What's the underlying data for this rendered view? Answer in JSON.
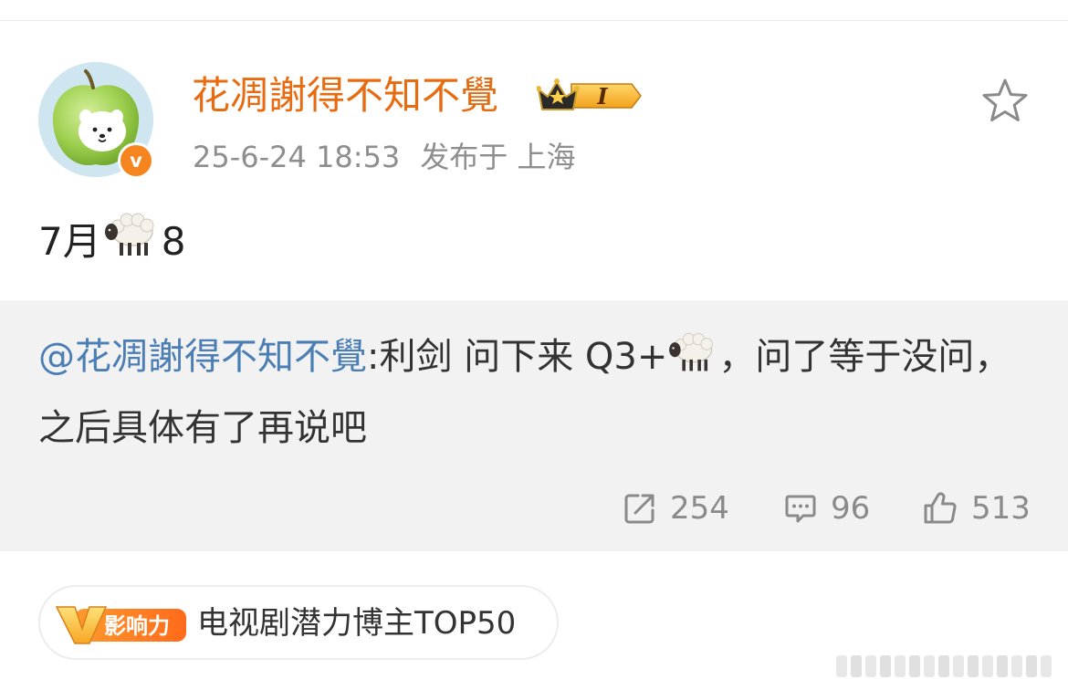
{
  "post": {
    "author": "花凋謝得不知不覺",
    "timestamp": "25-6-24 18:53",
    "location": "发布于 上海",
    "verified_letter": "v",
    "member_level": "I",
    "text_before": "7月",
    "text_emoji": "sheep-emoji",
    "text_after": "8",
    "star_icon": "star-icon"
  },
  "repost": {
    "mention": "@花凋謝得不知不覺",
    "text_part1": ":利剑 问下来 Q3+",
    "text_emoji": "sheep-emoji",
    "text_part2": "，问了等于没问，之后具体有了再说吧"
  },
  "actions": {
    "share_count": "254",
    "comment_count": "96",
    "like_count": "513",
    "share_icon": "share-icon",
    "comment_icon": "comment-icon",
    "like_icon": "thumbs-up-icon"
  },
  "tag": {
    "badge_text": "影响力",
    "badge_letter": "V",
    "label": "电视剧潜力博主TOP50"
  },
  "colors": {
    "author": "#e86b10",
    "mention": "#4a7eb4",
    "meta": "#8e8e8e",
    "repost_bg": "#f2f2f2",
    "badge_orange": "#f7851f"
  }
}
